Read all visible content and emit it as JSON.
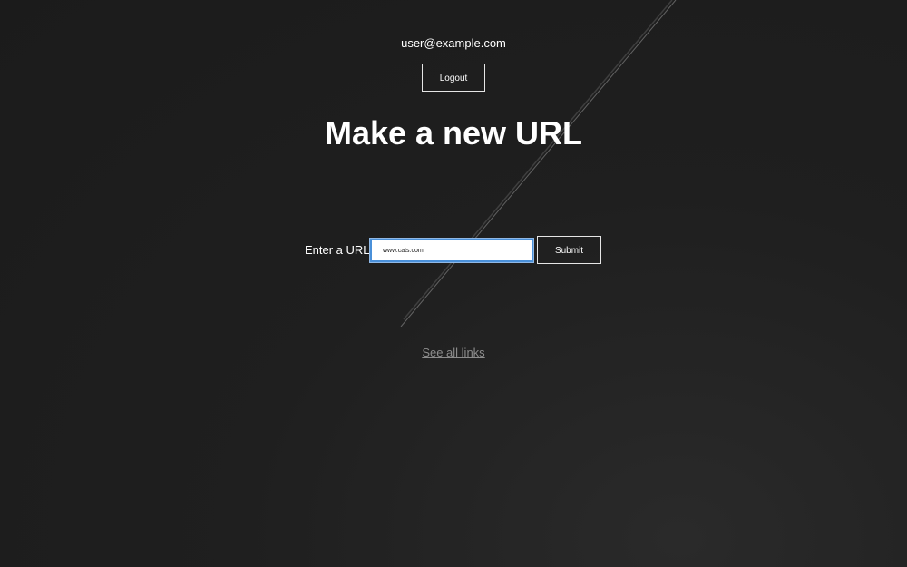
{
  "header": {
    "user_email": "user@example.com",
    "logout_label": "Logout"
  },
  "main": {
    "title": "Make a new URL",
    "form": {
      "label": "Enter a URL:",
      "input_value": "www.cats.com",
      "submit_label": "Submit"
    },
    "see_all_links_label": "See all links"
  },
  "colors": {
    "background": "#1d1d1d",
    "text": "#ffffff",
    "input_focus_border": "#4a90d9",
    "link": "#8c8c8c"
  }
}
